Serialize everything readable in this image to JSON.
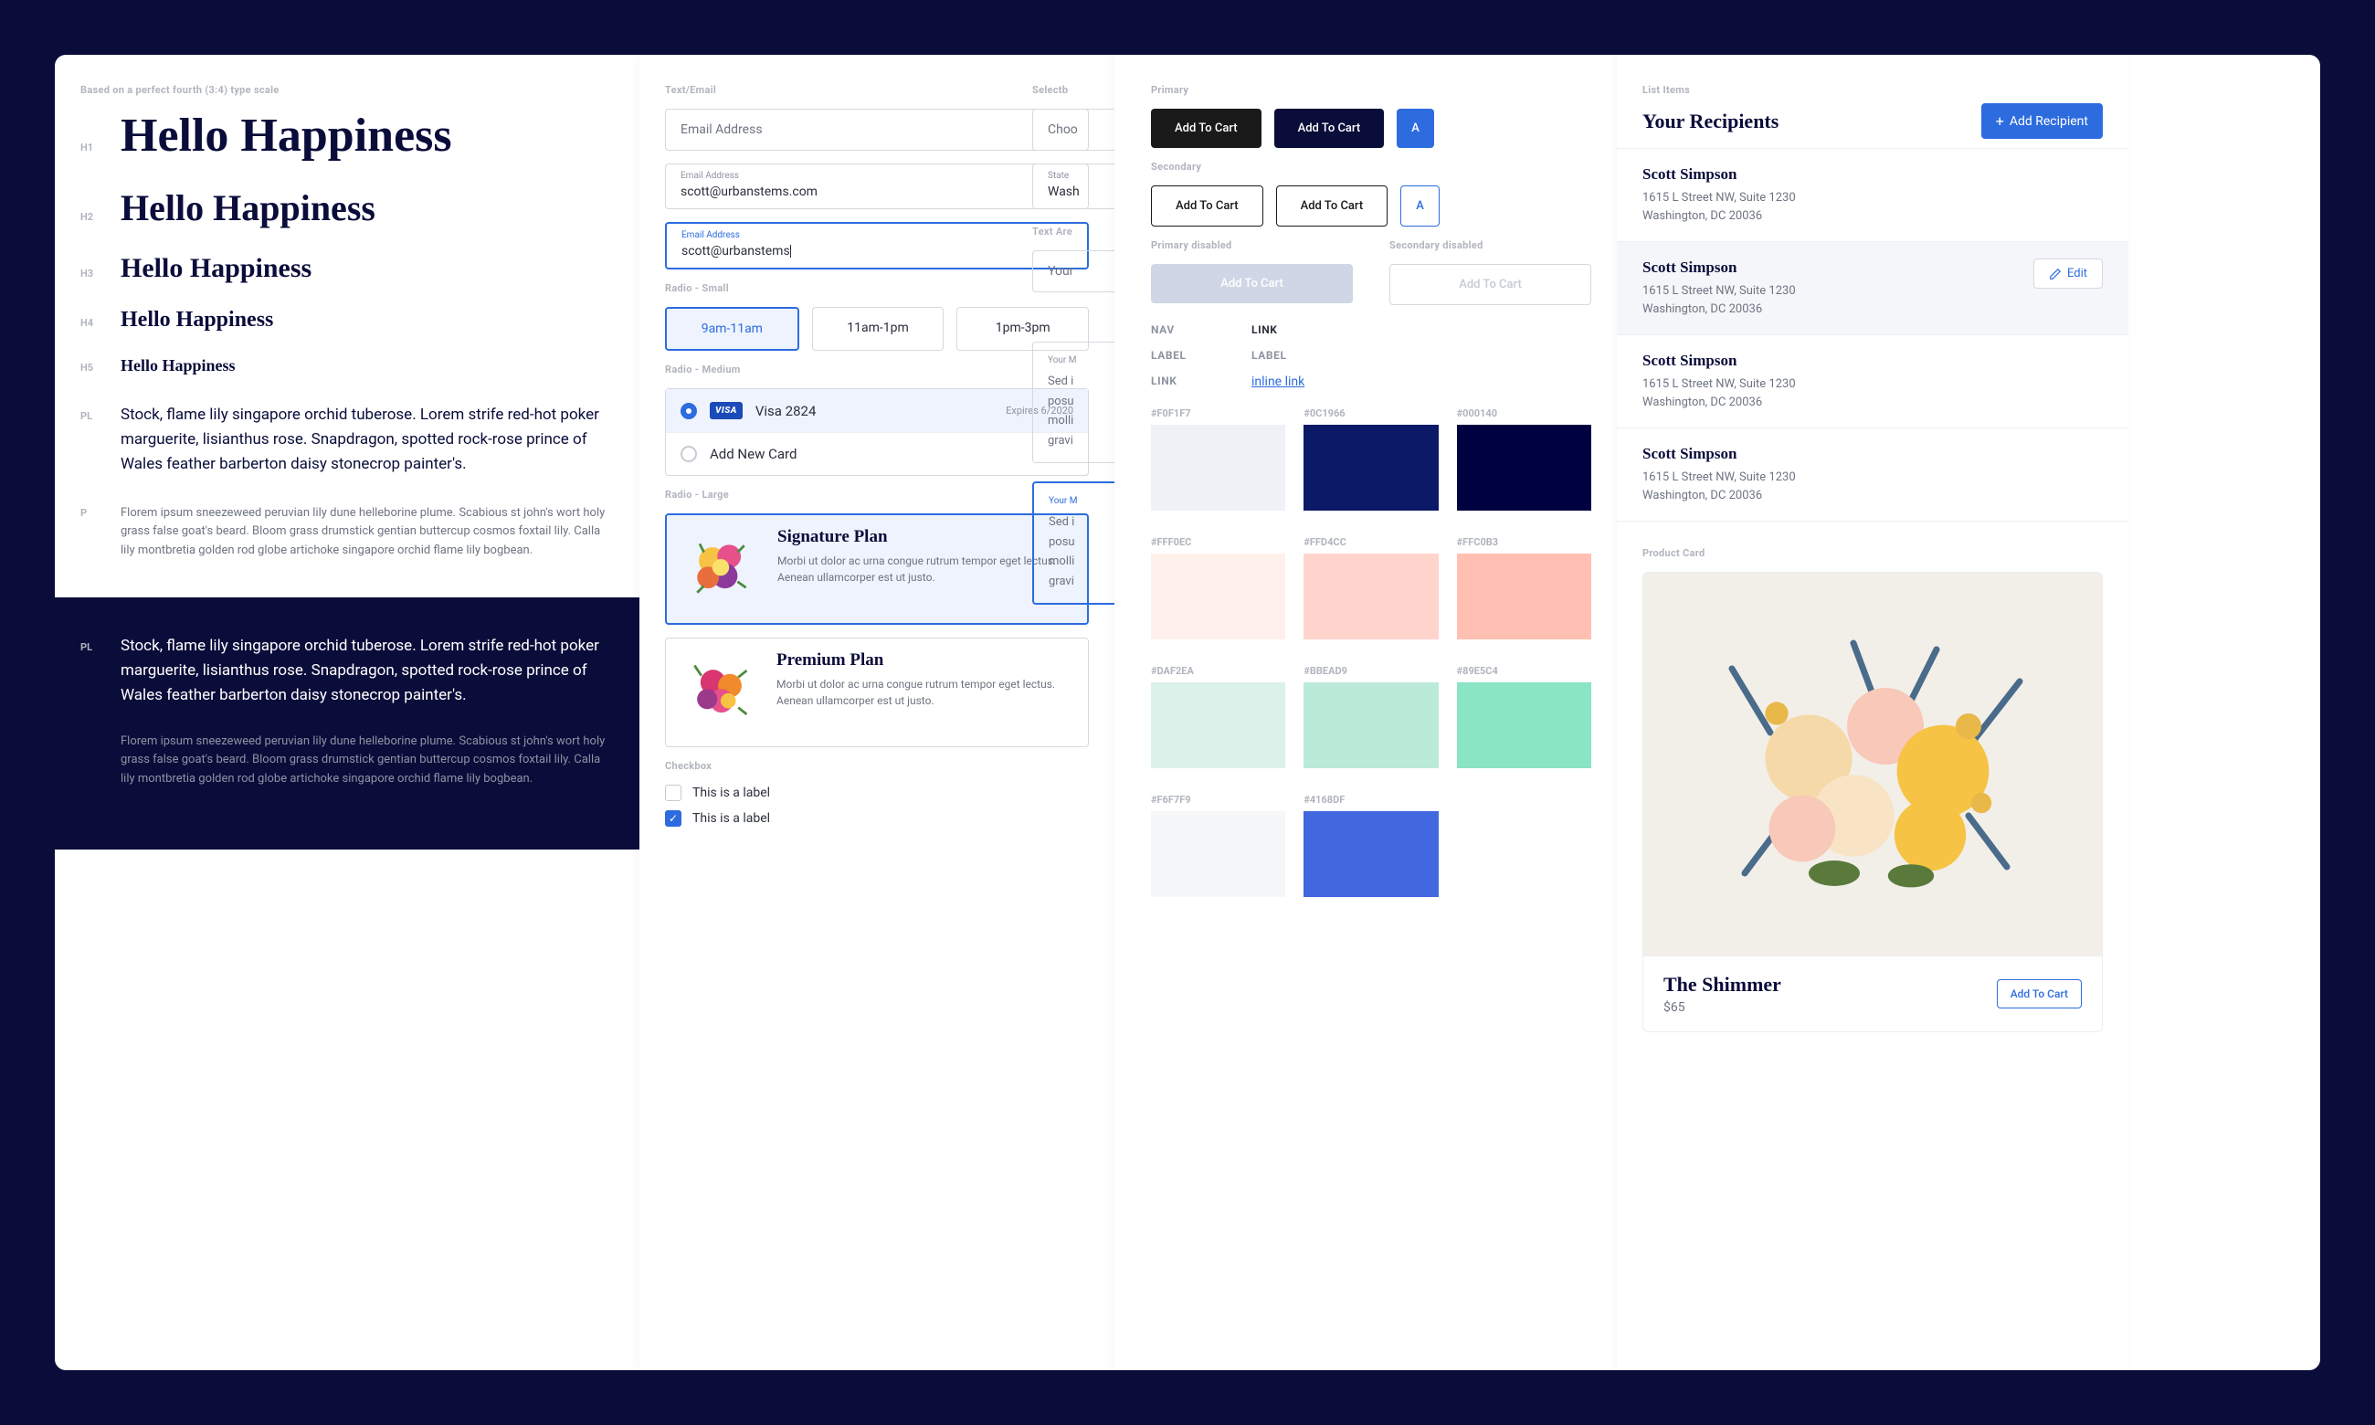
{
  "typography": {
    "scale_note": "Based on a perfect fourth (3:4) type scale",
    "h1": "Hello Happiness",
    "h2": "Hello Happiness",
    "h3": "Hello Happiness",
    "h4": "Hello Happiness",
    "h5": "Hello Happiness",
    "pl": "Stock, flame lily singapore orchid tuberose. Lorem strife red-hot poker marguerite, lisianthus rose. Snapdragon, spotted rock-rose prince of Wales feather barberton daisy stonecrop painter's.",
    "p": "Florem ipsum sneezeweed peruvian lily dune helleborine plume. Scabious st john's wort holy grass false goat's beard. Bloom grass drumstick gentian buttercup cosmos foxtail lily. Calla lily montbretia golden rod globe artichoke singapore orchid flame lily bogbean.",
    "pl_dark": "Stock, flame lily singapore orchid tuberose. Lorem strife red-hot poker marguerite, lisianthus rose. Snapdragon, spotted rock-rose prince of Wales feather barberton daisy stonecrop painter's.",
    "p_dark": "Florem ipsum sneezeweed peruvian lily dune helleborine plume. Scabious st john's wort holy grass false goat's beard. Bloom grass drumstick gentian buttercup cosmos foxtail lily. Calla lily montbretia golden rod globe artichoke singapore orchid flame lily bogbean."
  },
  "tags": {
    "h1": "H1",
    "h2": "H2",
    "h3": "H3",
    "h4": "H4",
    "h5": "H5",
    "pl": "PL",
    "p": "P"
  },
  "forms": {
    "text_email_label": "Text/Email",
    "email_placeholder": "Email Address",
    "email_float_label": "Email Address",
    "email_filled": "scott@urbanstems.com",
    "email_typing": "scott@urbanstems",
    "radio_small_label": "Radio - Small",
    "radio_small": [
      "9am-11am",
      "11am-1pm",
      "1pm-3pm"
    ],
    "radio_medium_label": "Radio - Medium",
    "visa_badge": "VISA",
    "visa_label": "Visa 2824",
    "visa_meta": "Expires 6/2020",
    "add_card": "Add New Card",
    "radio_large_label": "Radio - Large",
    "plan1_title": "Signature Plan",
    "plan1_desc": "Morbi ut dolor ac urna congue rutrum tempor eget lectus. Aenean ullamcorper est ut justo.",
    "plan2_title": "Premium Plan",
    "plan2_desc": "Morbi ut dolor ac urna congue rutrum tempor eget lectus. Aenean ullamcorper est ut justo.",
    "checkbox_label": "Checkbox",
    "checkbox1": "This is a label",
    "checkbox2": "This is a label",
    "selectbox_label": "Selectb",
    "selectbox_placeholder": "Choo",
    "selectbox_float_label": "State",
    "selectbox_float_value": "Wash",
    "textarea_label": "Text Are",
    "textarea_placeholder": "Your",
    "textarea_float_label": "Your M",
    "textarea_body1": "Sed i\nposu\nmolli\ngravi",
    "textarea_body2": "Sed i\nposu\nmolli\ngravi"
  },
  "buttons": {
    "primary_label": "Primary",
    "secondary_label": "Secondary",
    "primary_disabled_label": "Primary disabled",
    "secondary_disabled_label": "Secondary disabled",
    "add_to_cart": "Add To Cart",
    "a": "A",
    "nav": "NAV",
    "label": "LABEL",
    "link_label": "LINK",
    "link_value": "LINK",
    "inline_link": "inline link"
  },
  "swatches": [
    {
      "hex": "#F0F1F7"
    },
    {
      "hex": "#0C1966"
    },
    {
      "hex": "#000140"
    },
    {
      "hex": "#FFF0EC"
    },
    {
      "hex": "#FFD4CC"
    },
    {
      "hex": "#FFC0B3"
    },
    {
      "hex": "#DAF2EA"
    },
    {
      "hex": "#BBEAD9"
    },
    {
      "hex": "#89E5C4"
    },
    {
      "hex": "#F6F7F9"
    },
    {
      "hex": "#4168DF"
    }
  ],
  "recipients": {
    "section_label": "List Items",
    "title": "Your Recipients",
    "add_btn": "Add Recipient",
    "edit_btn": "Edit",
    "items": [
      {
        "name": "Scott Simpson",
        "line1": "1615 L Street NW, Suite 1230",
        "line2": "Washington, DC 20036"
      },
      {
        "name": "Scott Simpson",
        "line1": "1615 L Street NW, Suite 1230",
        "line2": "Washington, DC 20036"
      },
      {
        "name": "Scott Simpson",
        "line1": "1615 L Street NW, Suite 1230",
        "line2": "Washington, DC 20036"
      },
      {
        "name": "Scott Simpson",
        "line1": "1615 L Street NW, Suite 1230",
        "line2": "Washington, DC 20036"
      }
    ]
  },
  "product": {
    "section_label": "Product Card",
    "name": "The Shimmer",
    "price": "$65",
    "add_btn": "Add To Cart"
  }
}
